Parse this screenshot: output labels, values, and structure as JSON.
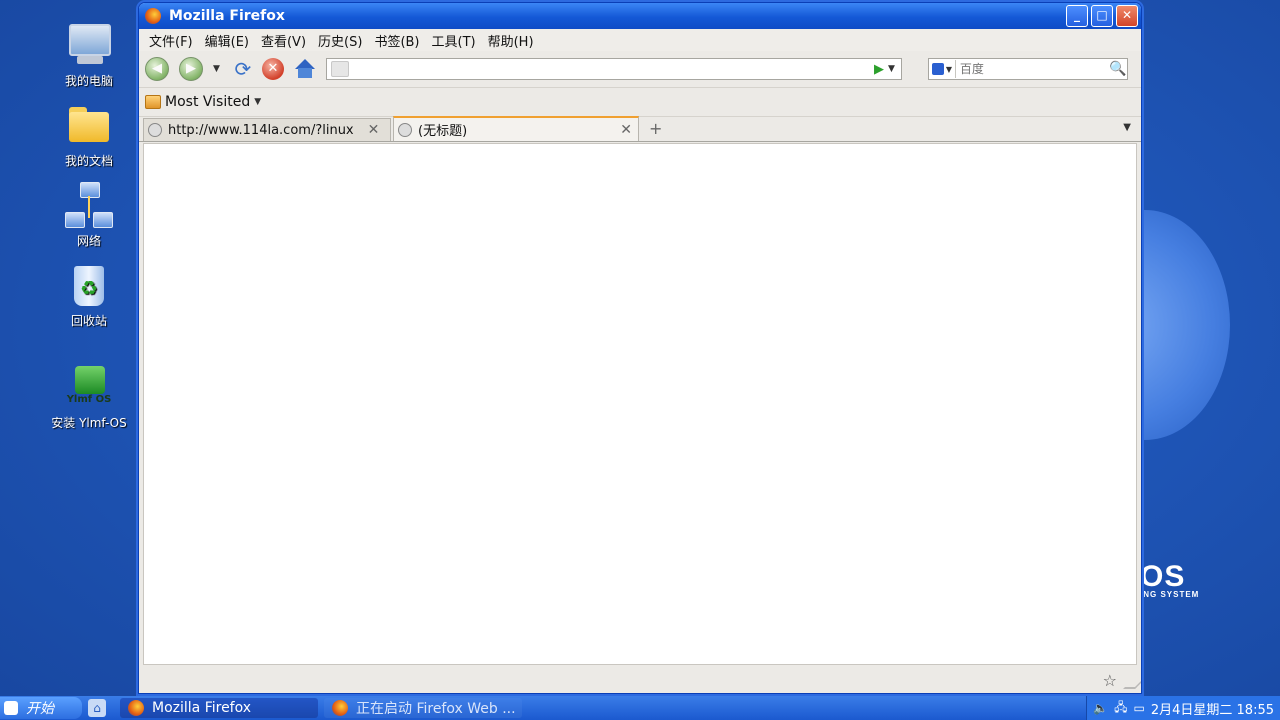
{
  "desktop": {
    "icons": [
      {
        "label": "我的电脑"
      },
      {
        "label": "我的文档"
      },
      {
        "label": "网络"
      },
      {
        "label": "回收站"
      },
      {
        "label": "安装 Ylmf-OS",
        "badge": "Ylmf OS"
      }
    ],
    "brand": {
      "big": "OS",
      "small": "ING SYSTEM"
    }
  },
  "window": {
    "title": "Mozilla Firefox",
    "controls": {
      "minimize": "_",
      "maximize": "□",
      "close": "✕"
    },
    "menu": [
      "文件(F)",
      "编辑(E)",
      "查看(V)",
      "历史(S)",
      "书签(B)",
      "工具(T)",
      "帮助(H)"
    ],
    "nav": {
      "back_icon": "back-arrow-icon",
      "forward_icon": "forward-arrow-icon",
      "url_value": "",
      "search_placeholder": "百度"
    },
    "bookmarks_toolbar": {
      "label": "Most Visited"
    },
    "tabs": [
      {
        "label": "http://www.114la.com/?linux",
        "active": false
      },
      {
        "label": "(无标题)",
        "active": true
      }
    ]
  },
  "taskbar": {
    "start_label": "开始",
    "tasks": [
      {
        "label": "Mozilla Firefox",
        "active": true
      },
      {
        "label": "正在启动 Firefox Web ...",
        "active": false
      }
    ],
    "clock": "2月4日星期二 18:55"
  },
  "colors": {
    "taskbar": "#1b59cf",
    "title": "#1458d6",
    "tab_accent": "#f0a030"
  }
}
